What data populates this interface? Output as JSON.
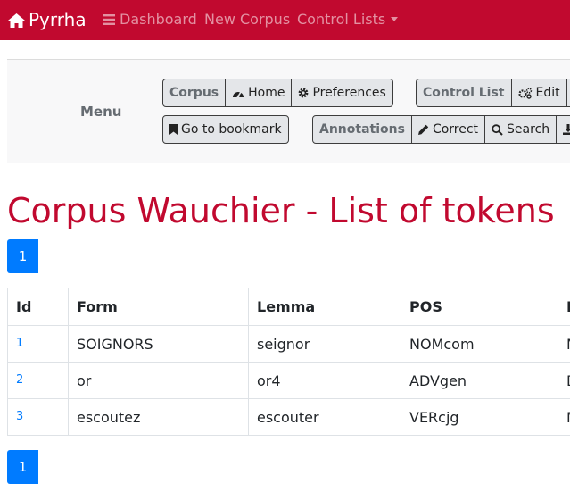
{
  "navbar": {
    "brand": "Pyrrha",
    "links": [
      {
        "label": "Dashboard",
        "icon": "bars-icon"
      },
      {
        "label": "New Corpus"
      },
      {
        "label": "Control Lists",
        "dropdown": true
      }
    ],
    "bg_color": "#c1092f"
  },
  "menu": {
    "title": "Menu",
    "corpus_group": {
      "label": "Corpus",
      "home": "Home",
      "preferences": "Preferences"
    },
    "bookmark": "Go to bookmark",
    "control_list_group": {
      "label": "Control List",
      "edit": "Edit"
    },
    "annotations_group": {
      "label": "Annotations",
      "correct": "Correct",
      "search": "Search",
      "export": "E"
    }
  },
  "page": {
    "title": "Corpus Wauchier - List of tokens",
    "pagination": [
      "1"
    ]
  },
  "table": {
    "headers": [
      "Id",
      "Form",
      "Lemma",
      "POS",
      "M"
    ],
    "rows": [
      {
        "id": "1",
        "form": "SOIGNORS",
        "lemma": "seignor",
        "pos": "NOMcom",
        "morph": "N"
      },
      {
        "id": "2",
        "form": "or",
        "lemma": "or4",
        "pos": "ADVgen",
        "morph": "D"
      },
      {
        "id": "3",
        "form": "escoutez",
        "lemma": "escouter",
        "pos": "VERcjg",
        "morph": "M"
      }
    ]
  },
  "colors": {
    "accent": "#c1092f",
    "link": "#007bff"
  }
}
